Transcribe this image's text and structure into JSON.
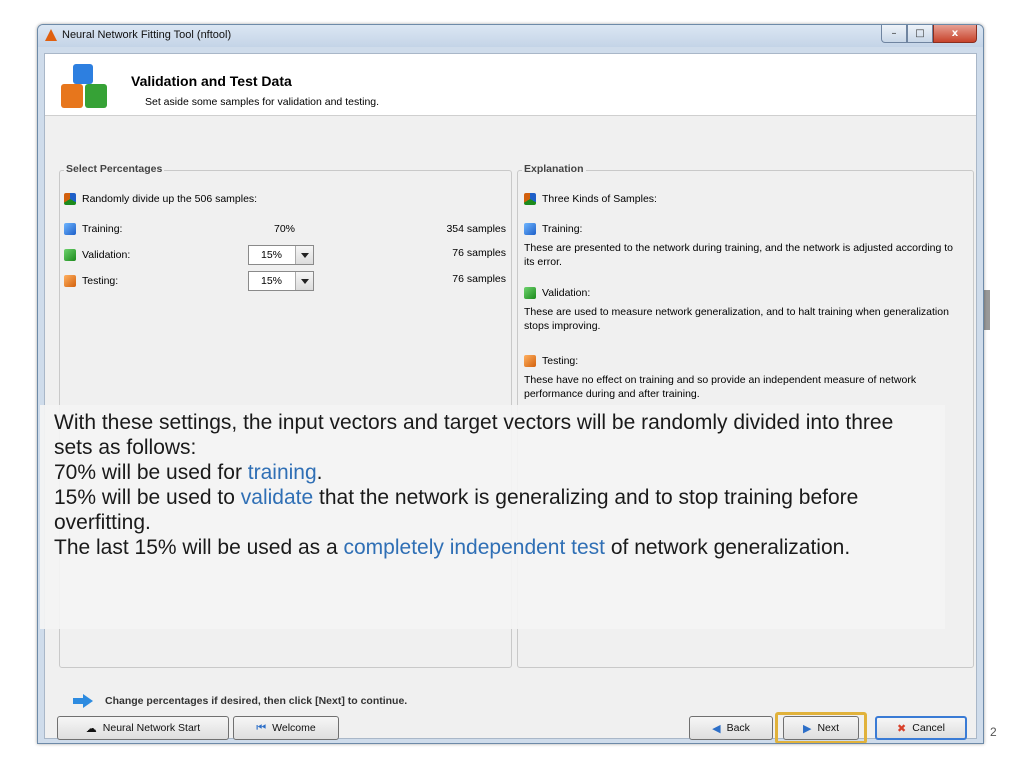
{
  "window": {
    "title": "Neural Network Fitting Tool (nftool)",
    "controls": {
      "minimize": "–",
      "maximize": "□",
      "close": "x"
    }
  },
  "header": {
    "title": "Validation and Test Data",
    "subtitle": "Set aside some samples for validation and testing."
  },
  "select_percentages": {
    "legend": "Select Percentages",
    "intro": "Randomly divide up the 506 samples:",
    "rows": [
      {
        "label": "Training:",
        "percent": "70%",
        "samples": "354 samples",
        "editable": false
      },
      {
        "label": "Validation:",
        "percent": "15%",
        "samples": "76 samples",
        "editable": true
      },
      {
        "label": "Testing:",
        "percent": "15%",
        "samples": "76 samples",
        "editable": true
      }
    ]
  },
  "explanation": {
    "legend": "Explanation",
    "intro": "Three Kinds of Samples:",
    "items": [
      {
        "heading": "Training:",
        "text": "These are presented to the network during training, and the network is adjusted according to its error."
      },
      {
        "heading": "Validation:",
        "text": "These are used to measure network generalization, and to halt training when generalization stops improving."
      },
      {
        "heading": "Testing:",
        "text": "These have no effect on training and so provide an independent measure of network performance during and after training."
      }
    ]
  },
  "footer": {
    "hint": "Change percentages if desired, then click [Next] to continue.",
    "buttons": {
      "nn_start": "Neural Network Start",
      "welcome": "Welcome",
      "back": "Back",
      "next": "Next",
      "cancel": "Cancel"
    }
  },
  "overlay": {
    "line1": "With these settings, the input vectors and target vectors will be randomly divided into three sets as follows:",
    "l2_pre": "70% will be used for ",
    "l2_accent": "training",
    "l2_post": ".",
    "l3_pre": "15% will be used to ",
    "l3_accent": "validate",
    "l3_post": " that the network is generalizing and to stop training before overfitting.",
    "l4_pre": "The last 15% will be used as a ",
    "l4_accent": "completely independent test",
    "l4_post": " of network generalization."
  },
  "page_number": "2",
  "colors": {
    "accent_text": "#2f6fb5",
    "focus_border": "#e1b23b"
  }
}
